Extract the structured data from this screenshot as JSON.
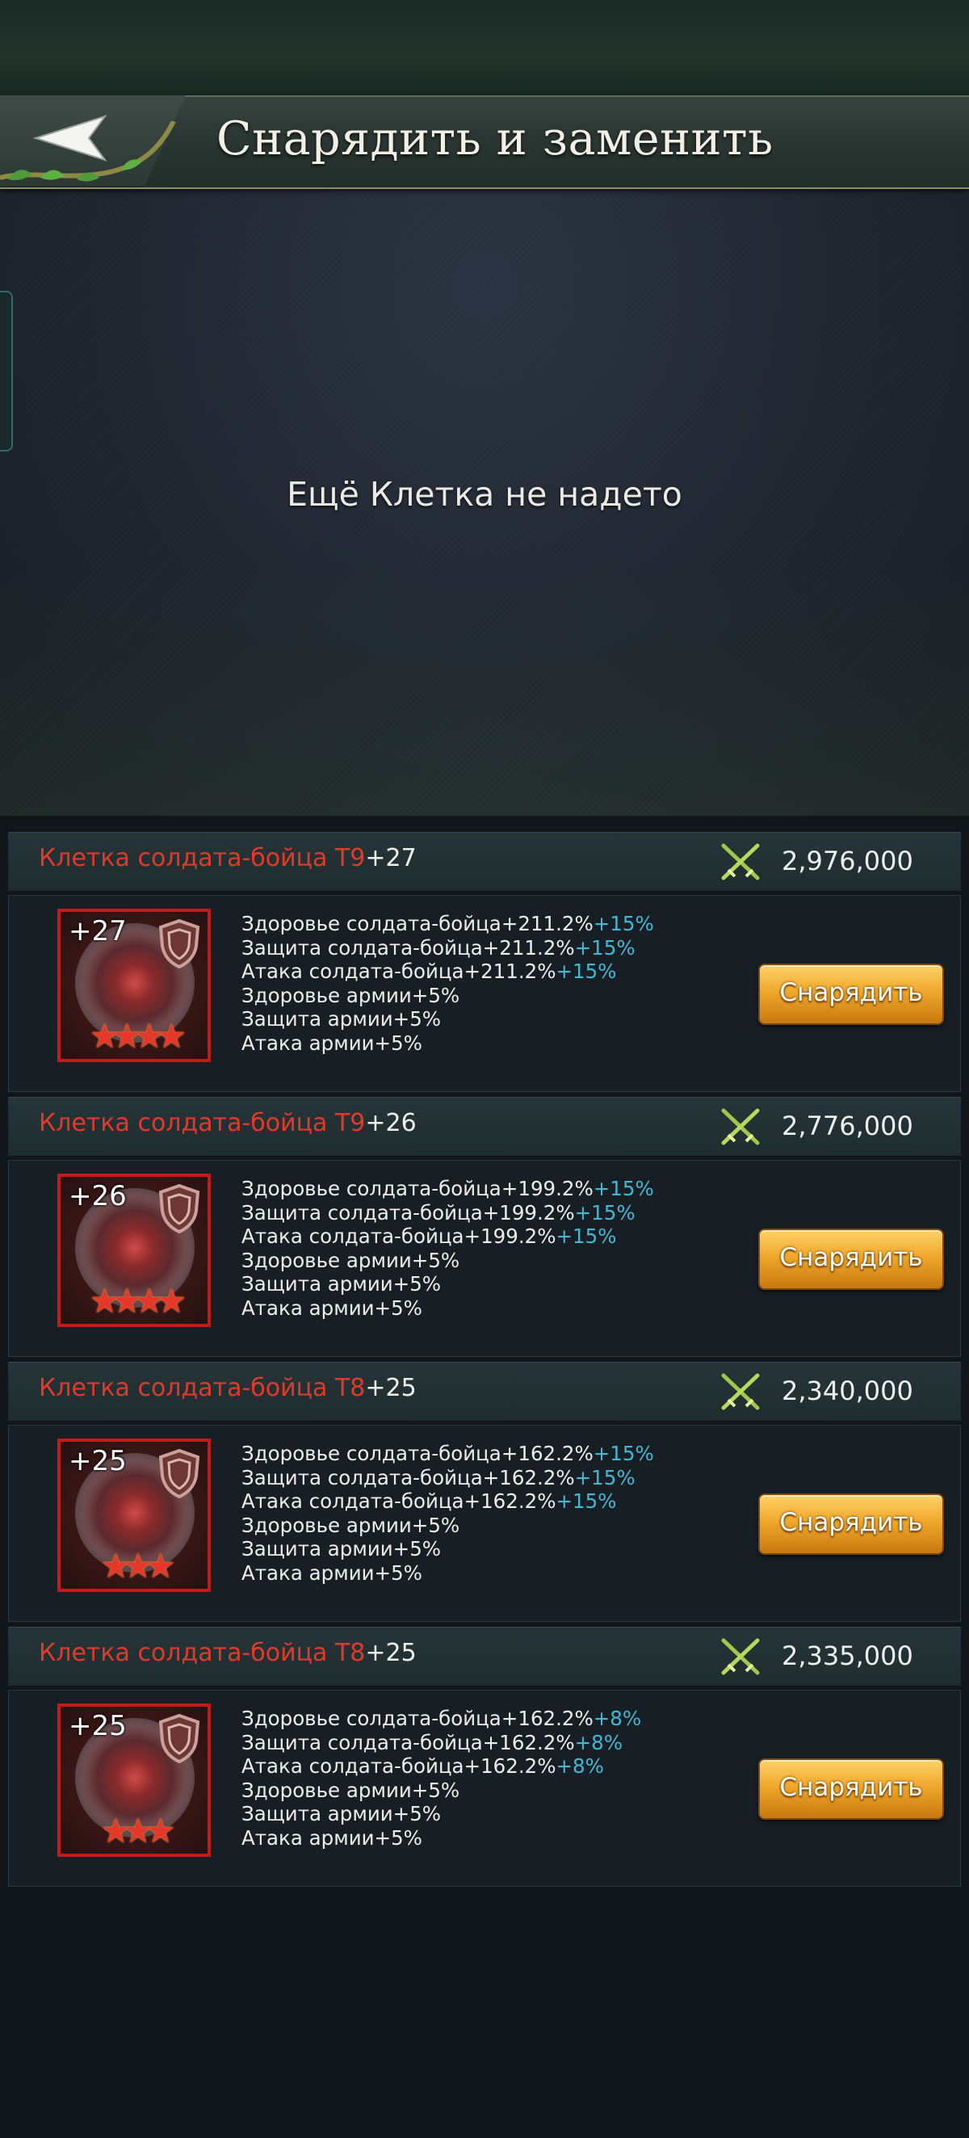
{
  "header": {
    "title": "Снарядить и заменить"
  },
  "equipped": {
    "empty_message": "Ещё Клетка не надето"
  },
  "items": [
    {
      "name": "Клетка солдата-бойца T9",
      "level": "+27",
      "power": "2,976,000",
      "stars": "★★★★",
      "stats": [
        {
          "text": "Здоровье солдата-бойца+211.2%",
          "bonus": "+15%"
        },
        {
          "text": "Защита солдата-бойца+211.2%",
          "bonus": "+15%"
        },
        {
          "text": "Атака солдата-бойца+211.2%",
          "bonus": "+15%"
        },
        {
          "text": "Здоровье армии+5%",
          "bonus": ""
        },
        {
          "text": "Защита армии+5%",
          "bonus": ""
        },
        {
          "text": "Атака армии+5%",
          "bonus": ""
        }
      ],
      "button": "Снарядить"
    },
    {
      "name": "Клетка солдата-бойца T9",
      "level": "+26",
      "power": "2,776,000",
      "stars": "★★★★",
      "stats": [
        {
          "text": "Здоровье солдата-бойца+199.2%",
          "bonus": "+15%"
        },
        {
          "text": "Защита солдата-бойца+199.2%",
          "bonus": "+15%"
        },
        {
          "text": "Атака солдата-бойца+199.2%",
          "bonus": "+15%"
        },
        {
          "text": "Здоровье армии+5%",
          "bonus": ""
        },
        {
          "text": "Защита армии+5%",
          "bonus": ""
        },
        {
          "text": "Атака армии+5%",
          "bonus": ""
        }
      ],
      "button": "Снарядить"
    },
    {
      "name": "Клетка солдата-бойца T8",
      "level": "+25",
      "power": "2,340,000",
      "stars": "★★★",
      "stats": [
        {
          "text": "Здоровье солдата-бойца+162.2%",
          "bonus": "+15%"
        },
        {
          "text": "Защита солдата-бойца+162.2%",
          "bonus": "+15%"
        },
        {
          "text": "Атака солдата-бойца+162.2%",
          "bonus": "+15%"
        },
        {
          "text": "Здоровье армии+5%",
          "bonus": ""
        },
        {
          "text": "Защита армии+5%",
          "bonus": ""
        },
        {
          "text": "Атака армии+5%",
          "bonus": ""
        }
      ],
      "button": "Снарядить"
    },
    {
      "name": "Клетка солдата-бойца T8",
      "level": "+25",
      "power": "2,335,000",
      "stars": "★★★",
      "stats": [
        {
          "text": "Здоровье солдата-бойца+162.2%",
          "bonus": "+8%"
        },
        {
          "text": "Защита солдата-бойца+162.2%",
          "bonus": "+8%"
        },
        {
          "text": "Атака солдата-бойца+162.2%",
          "bonus": "+8%"
        },
        {
          "text": "Здоровье армии+5%",
          "bonus": ""
        },
        {
          "text": "Защита армии+5%",
          "bonus": ""
        },
        {
          "text": "Атака армии+5%",
          "bonus": ""
        }
      ],
      "button": "Снарядить"
    }
  ],
  "colors": {
    "name_red": "#e23a2a",
    "bonus_blue": "#3fb9d6",
    "button_gold": "#f0a82c",
    "frame_red": "#c51b16"
  },
  "icons": {
    "back": "back-arrow-icon",
    "power": "crossed-swords-icon",
    "shield": "shield-icon"
  }
}
